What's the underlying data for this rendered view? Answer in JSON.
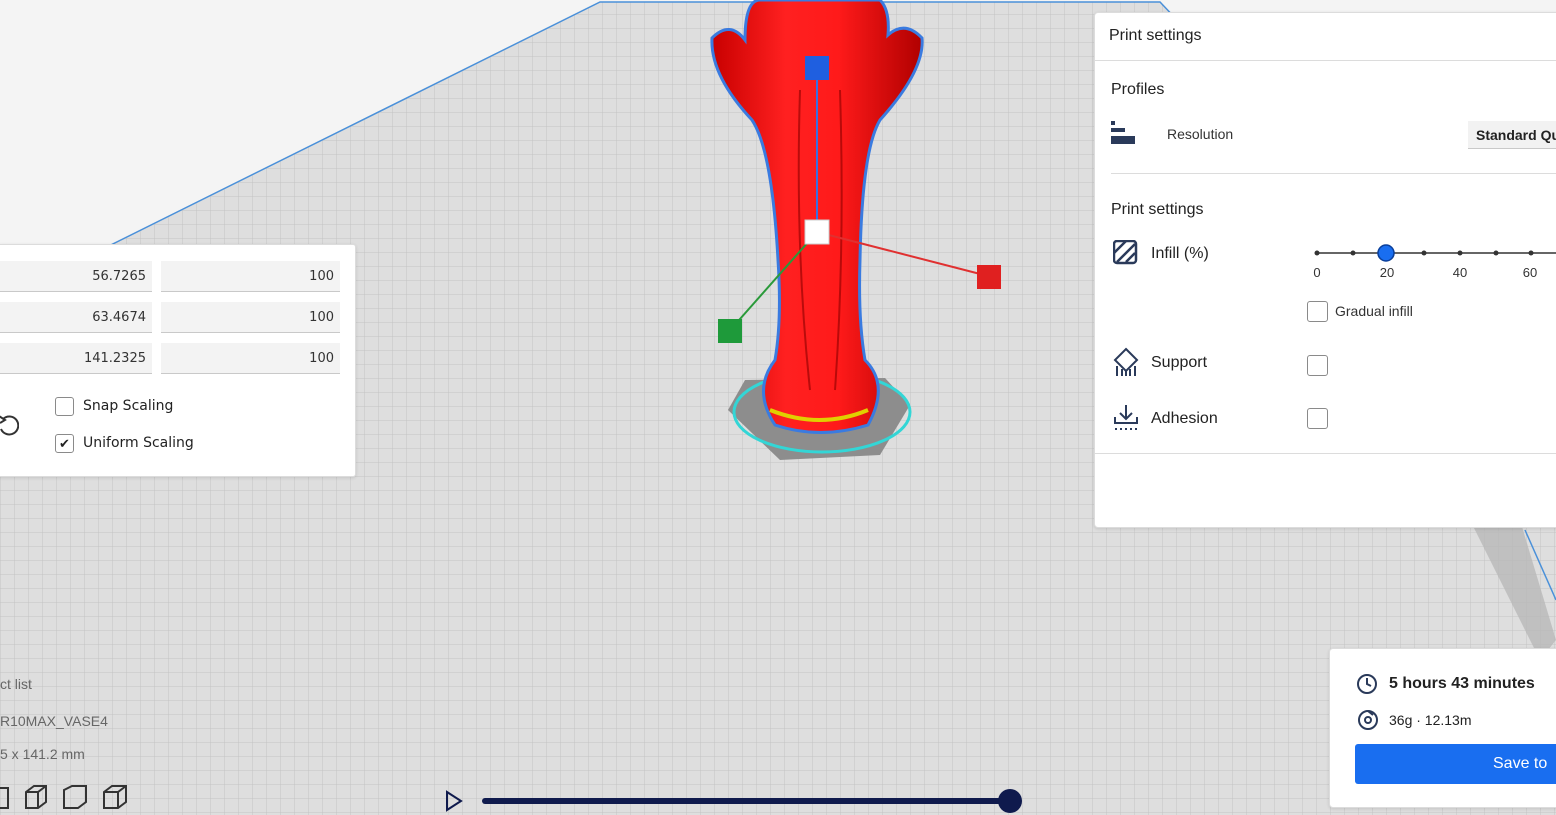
{
  "viewport": {
    "bed_color": "#dcdcdc",
    "model_color": "#ff1a1a",
    "axis_colors": {
      "x": "#e02020",
      "y": "#1e9a3a",
      "z": "#1f5fe0"
    }
  },
  "scale_panel": {
    "rows": [
      {
        "mm": "56.7265",
        "percent": "100"
      },
      {
        "mm": "63.4674",
        "percent": "100"
      },
      {
        "mm": "141.2325",
        "percent": "100"
      }
    ],
    "snap_scaling_label": "Snap Scaling",
    "snap_scaling_checked": false,
    "uniform_scaling_label": "Uniform Scaling",
    "uniform_scaling_checked": true,
    "reset_icon": "reset-rotate-icon"
  },
  "print_settings": {
    "header": "Print settings",
    "profiles_title": "Profiles",
    "resolution_label": "Resolution",
    "resolution_value": "Standard Qu",
    "settings_title": "Print settings",
    "infill_label": "Infill (%)",
    "infill_value": 20,
    "infill_ticks": [
      "0",
      "20",
      "40",
      "60"
    ],
    "gradual_infill_label": "Gradual infill",
    "support_label": "Support",
    "adhesion_label": "Adhesion",
    "accent_color": "#196ef0"
  },
  "object_list": {
    "title": "ct list",
    "name": "R10MAX_VASE4",
    "dimensions": "5 x 141.2 mm"
  },
  "job": {
    "time": "5 hours 43 minutes",
    "material": "36g · 12.13m",
    "save_label": "Save to"
  }
}
